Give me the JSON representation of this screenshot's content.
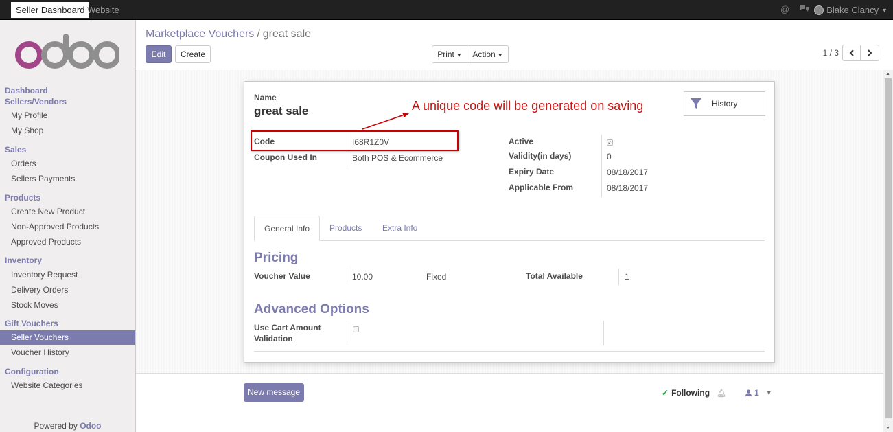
{
  "topbar": {
    "apps": [
      "Seller Dashboard",
      "Website"
    ],
    "user_name": "Blake Clancy",
    "icons": [
      "at-icon",
      "chat-icon",
      "avatar"
    ]
  },
  "sidebar": {
    "logo_text": "odoo",
    "groups": [
      {
        "title": "Dashboard"
      },
      {
        "title": "Sellers/Vendors",
        "items": [
          "My Profile",
          "My Shop"
        ]
      },
      {
        "title": "Sales",
        "items": [
          "Orders",
          "Sellers Payments"
        ]
      },
      {
        "title": "Products",
        "items": [
          "Create New Product",
          "Non-Approved Products",
          "Approved Products"
        ]
      },
      {
        "title": "Inventory",
        "items": [
          "Inventory Request",
          "Delivery Orders",
          "Stock Moves"
        ]
      },
      {
        "title": "Gift Vouchers",
        "items": [
          "Seller Vouchers",
          "Voucher History"
        ]
      },
      {
        "title": "Configuration",
        "items": [
          "Website Categories"
        ]
      }
    ],
    "active_item": "Seller Vouchers",
    "powered_by": "Powered by",
    "powered_brand": "Odoo"
  },
  "control_panel": {
    "breadcrumb_parent": "Marketplace Vouchers",
    "breadcrumb_sep": "/",
    "breadcrumb_current": "great sale",
    "edit_label": "Edit",
    "create_label": "Create",
    "print_label": "Print",
    "action_label": "Action",
    "pager_value": "1 / 3"
  },
  "form": {
    "name_label": "Name",
    "name_value": "great sale",
    "history_label": "History",
    "code_label": "Code",
    "code_value": "I68R1Z0V",
    "coupon_used_label": "Coupon Used In",
    "coupon_used_value": "Both POS & Ecommerce",
    "active_label": "Active",
    "active_checked": true,
    "validity_label": "Validity(in days)",
    "validity_value": "0",
    "expiry_label": "Expiry Date",
    "expiry_value": "08/18/2017",
    "applicable_label": "Applicable From",
    "applicable_value": "08/18/2017",
    "tabs": [
      "General Info",
      "Products",
      "Extra Info"
    ],
    "active_tab": "General Info",
    "pricing_title": "Pricing",
    "voucher_value_label": "Voucher Value",
    "voucher_value": "10.00",
    "voucher_type": "Fixed",
    "total_available_label": "Total Available",
    "total_available_value": "1",
    "advanced_title": "Advanced Options",
    "cart_validation_label_1": "Use Cart Amount",
    "cart_validation_label_2": "Validation",
    "cart_validation_checked": false
  },
  "annotation": {
    "text": "A unique code will be generated on saving",
    "color": "#cc1111"
  },
  "chatter": {
    "new_message_label": "New message",
    "following_label": "Following",
    "followers_count": "1"
  },
  "colors": {
    "brand": "#7c7bad",
    "topbar": "#212121",
    "sidebar_bg": "#f0eeee"
  }
}
